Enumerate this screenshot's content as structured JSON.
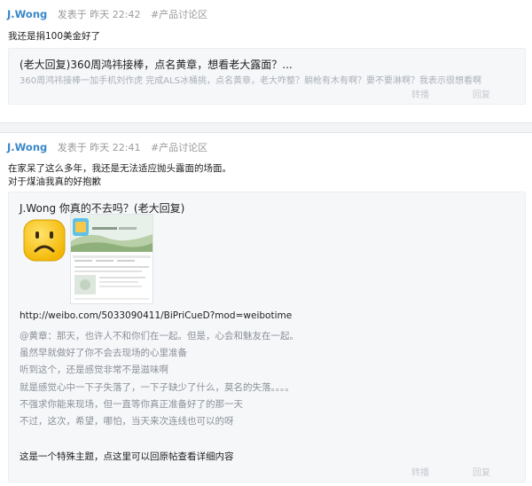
{
  "post1": {
    "author": "J.Wong",
    "time": "发表于 昨天 22:42",
    "topic": "#产品讨论区",
    "body": "我还是捐100美金好了",
    "quote": {
      "title": "(老大回复)360周鸿祎接棒，点名黄章，想看老大露面？...",
      "subtitle": "360周鸿祎接棒一加手机刘作虎 完成ALS冰桶挑，点名黄章，老大咋整？躺枪有木有啊？要不要淋啊？我表示很想看啊",
      "action_forward": "转播",
      "action_reply": "回复"
    }
  },
  "post2": {
    "author": "J.Wong",
    "time": "发表于 昨天 22:41",
    "topic": "#产品讨论区",
    "body_lines": [
      "在家呆了这么多年，我还是无法适应抛头露面的场面。",
      "对于煤油我真的好抱歉"
    ],
    "quote": {
      "title": "J.Wong 你真的不去吗？(老大回复)",
      "link": "http://weibo.com/5033090411/BiPriCueD?mod=weibotime",
      "lines": [
        "@黄章：那天，也许人不和你们在一起。但是，心会和魅友在一起。",
        "虽然早就做好了你不会去现场的心里准备",
        "听到这个，还是感觉非常不是滋味啊",
        "就是感觉心中一下子失落了，一下子缺少了什么，莫名的失落。。。。",
        "不强求你能来现场，但一直等你真正准备好了的那一天",
        "不过，这次，希望，哪怕，当天来次连线也可以的呀"
      ],
      "footer": "这是一个特殊主题，点这里可以回原帖查看详细内容",
      "action_forward": "转播",
      "action_reply": "回复"
    },
    "emoji_icon": "sad-face-icon",
    "thumbnail": "weibo-screenshot-thumbnail"
  },
  "colors": {
    "author": "#3a87c8",
    "meta": "#9a9a9a",
    "quote_bg": "#f6f7f9",
    "muted": "#a8b0b8",
    "emoji": "#f6c21a"
  }
}
